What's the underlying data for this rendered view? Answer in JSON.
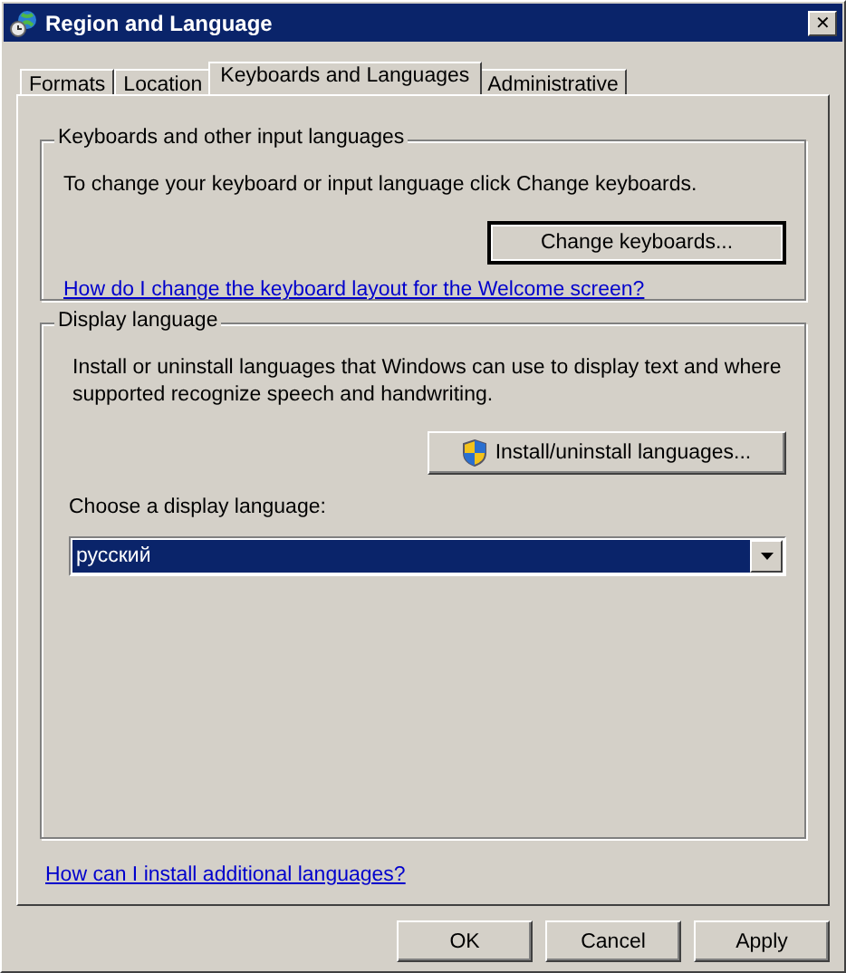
{
  "window": {
    "title": "Region and Language",
    "close": "✕"
  },
  "tabs": [
    {
      "label": "Formats",
      "selected": false
    },
    {
      "label": "Location",
      "selected": false
    },
    {
      "label": "Keyboards and Languages",
      "selected": true
    },
    {
      "label": "Administrative",
      "selected": false
    }
  ],
  "keyboards_group": {
    "title": "Keyboards and other input languages",
    "description": "To change your keyboard or input language click Change keyboards.",
    "button": "Change keyboards...",
    "link": "How do I change the keyboard layout for the Welcome screen?"
  },
  "display_group": {
    "title": "Display language",
    "description": "Install or uninstall languages that Windows can use to display text and where supported recognize speech and handwriting.",
    "button": "Install/uninstall languages...",
    "choose_label": "Choose a display language:",
    "dropdown": {
      "value": "русский"
    }
  },
  "help_link": "How can I install additional languages?",
  "buttons": [
    "OK",
    "Cancel",
    "Apply"
  ]
}
